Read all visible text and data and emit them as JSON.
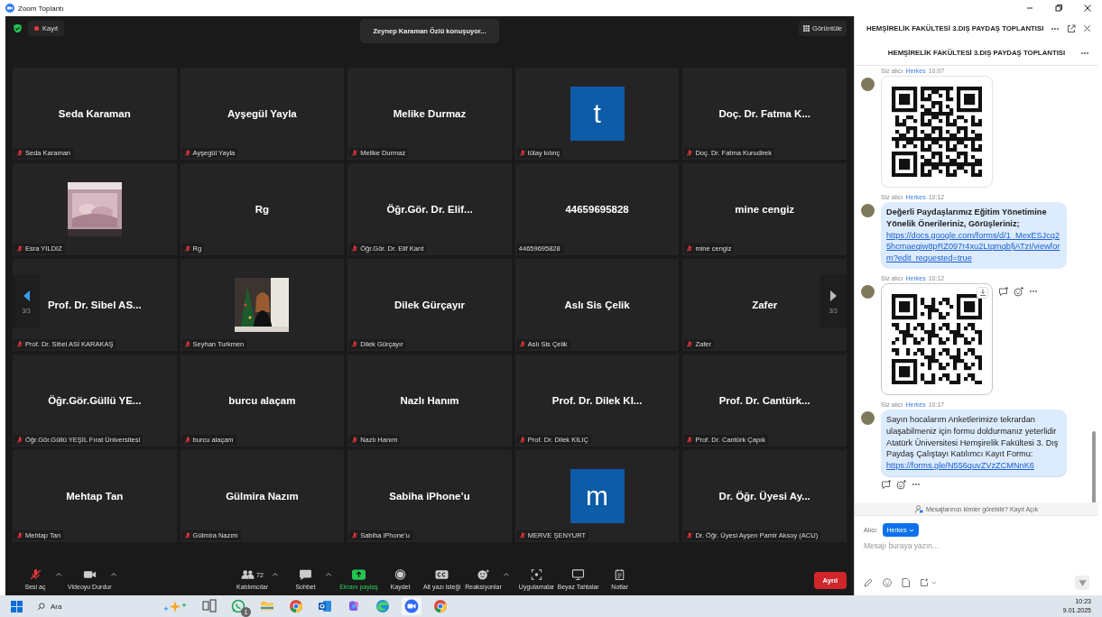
{
  "window": {
    "title": "Zoom Toplantı"
  },
  "top_bar": {
    "recording": "Kayıt",
    "speaking": "Zeynep Karaman Özlü konuşuyor...",
    "view_button": "Görüntüle"
  },
  "tiles": [
    {
      "kind": "name",
      "display": "Seda Karaman",
      "label": "Seda Karaman",
      "muted": true
    },
    {
      "kind": "name",
      "display": "Ayşegül Yayla",
      "label": "Ayşegül Yayla",
      "muted": true
    },
    {
      "kind": "name",
      "display": "Melike Durmaz",
      "label": "Melike Durmaz",
      "muted": true
    },
    {
      "kind": "avatar",
      "display": "t",
      "label": "tülay kılınç",
      "muted": true
    },
    {
      "kind": "name",
      "display": "Doç. Dr. Fatma K...",
      "label": "Doç. Dr. Fatma Kurudirek",
      "muted": true
    },
    {
      "kind": "picture",
      "label": "Esra YILDIZ",
      "muted": true
    },
    {
      "kind": "name",
      "display": "Rg",
      "label": "Rg",
      "muted": true
    },
    {
      "kind": "name",
      "display": "Öğr.Gör. Dr. Elif...",
      "label": "Öğr.Gör. Dr. Elif Kant",
      "muted": true
    },
    {
      "kind": "name",
      "display": "44659695828",
      "label": "44659695828",
      "muted": false
    },
    {
      "kind": "name",
      "display": "mine cengiz",
      "label": "mine cengiz",
      "muted": true
    },
    {
      "kind": "name",
      "display": "Prof. Dr. Sibel AS...",
      "label": "Prof. Dr. Sibel ASİ KARAKAŞ",
      "muted": true
    },
    {
      "kind": "picture",
      "label": "Seyhan Turkmen",
      "muted": true
    },
    {
      "kind": "name",
      "display": "Dilek Gürçayır",
      "label": "Dilek Gürçayır",
      "muted": true
    },
    {
      "kind": "name",
      "display": "Aslı Sis Çelik",
      "label": "Aslı Sis Çelik",
      "muted": true
    },
    {
      "kind": "name",
      "display": "Zafer",
      "label": "Zafer",
      "muted": true
    },
    {
      "kind": "name",
      "display": "Öğr.Gör.Güllü  YE...",
      "label": "Öğr.Gör.Güllü YEŞİL Fırat Üniversitesi",
      "muted": true
    },
    {
      "kind": "name",
      "display": "burcu alaçam",
      "label": "burcu alaçam",
      "muted": true
    },
    {
      "kind": "name",
      "display": "Nazlı Hanım",
      "label": "Nazlı Hanım",
      "muted": true
    },
    {
      "kind": "name",
      "display": "Prof. Dr. Dilek KI...",
      "label": "Prof. Dr. Dilek KILIÇ",
      "muted": true
    },
    {
      "kind": "name",
      "display": "Prof. Dr. Cantürk...",
      "label": "Prof. Dr. Cantürk Çapık",
      "muted": true
    },
    {
      "kind": "name",
      "display": "Mehtap Tan",
      "label": "Mehtap Tan",
      "muted": true
    },
    {
      "kind": "name",
      "display": "Gülmira Nazım",
      "label": "Gülmira Nazım",
      "muted": true
    },
    {
      "kind": "name",
      "display": "Sabiha iPhone’u",
      "label": "Sabiha iPhone’u",
      "muted": true
    },
    {
      "kind": "avatar",
      "display": "m",
      "label": "MERVE ŞENYURT",
      "muted": true
    },
    {
      "kind": "name",
      "display": "Dr. Öğr. Üyesi Ay...",
      "label": "Dr. Öğr. Üyesi Ayşen Pamir Aksoy (ACU)",
      "muted": true
    }
  ],
  "pager": {
    "left": "3/3",
    "right": "3/3"
  },
  "toolbar": {
    "left": [
      {
        "kind": "audio",
        "label": "Sesi aç",
        "muted": true,
        "menu": true
      },
      {
        "kind": "video",
        "label": "Videoyu Durdur",
        "menu": true
      }
    ],
    "center": [
      {
        "kind": "participants",
        "label": "Katılımcılar",
        "count": "72",
        "menu": true
      },
      {
        "kind": "chat",
        "label": "Sohbet",
        "menu": true
      },
      {
        "kind": "share",
        "label": "Ekranı paylaş",
        "menu": false
      },
      {
        "kind": "record",
        "label": "Kaydet",
        "menu": false
      },
      {
        "kind": "captions",
        "label": "Alt yazı isteği",
        "menu": false
      },
      {
        "kind": "reactions",
        "label": "Reaksiyonlar",
        "menu": true
      },
      {
        "kind": "apps",
        "label": "Uygulamalar",
        "menu": false
      },
      {
        "kind": "whiteboard",
        "label": "Beyaz Tahtalar",
        "menu": false
      },
      {
        "kind": "notes",
        "label": "Notlar",
        "menu": false
      }
    ],
    "leave_button": "Ayrıl"
  },
  "chat": {
    "title": "HEMŞİRELİK FAKÜLTESİ 3.DIŞ PAYDAŞ TOPLANTISI",
    "subtitle": "HEMŞİRELİK FAKÜLTESİ 3.DIŞ PAYDAŞ TOPLANTISI",
    "messages": [
      {
        "from": "Siz alıcı",
        "recipient": "Herkes",
        "time": "10:07",
        "side_actions": false,
        "below_actions": false
      },
      {
        "kind": "text",
        "from": "Siz alıcı",
        "recipient": "Herkes",
        "time": "10:12",
        "heading": "Değerli Paydaşlarımız Eğitim Yönetimine Yönelik Önerileriniz, Görüşleriniz;",
        "link": "https://docs.google.com/forms/d/1_MexESJcq25hcmaegiw8pRZ097r4xu2LtgmgbfjATzI/viewform?edit_requested=true",
        "side_actions": false,
        "below_actions": false
      },
      {
        "from": "Siz alıcı",
        "recipient": "Herkes",
        "time": "10:12",
        "side_actions": true,
        "below_actions": false
      },
      {
        "kind": "text",
        "from": "Siz alıcı",
        "recipient": "Herkes",
        "time": "10:17",
        "text": "Sayın hocalarım Anketlerimize tekrardan ulaşabilmeniz için formu doldurmanız yeterlidir Atatürk Üniversitesi Hemşirelik Fakültesi 3. Dış Paydaş Çalıştayı Katılımcı Kayıt Formu:",
        "link": "https://forms.gle/N556quvZVzZCMNnK6",
        "side_actions": false,
        "below_actions": true
      }
    ],
    "notice": "Mesajlarınızı kimler görebilir? Kayıt Açık",
    "recipient_label": "Alıcı:",
    "recipient": "Herkes",
    "placeholder": "Mesajı buraya yazın..."
  },
  "taskbar": {
    "search": "Ara",
    "apps": [
      {
        "kind": "task-view",
        "selected": false
      },
      {
        "kind": "whatsapp",
        "badge": "1",
        "selected": false
      },
      {
        "kind": "folder",
        "selected": false
      },
      {
        "kind": "chrome",
        "selected": false
      },
      {
        "kind": "outlook",
        "selected": false
      },
      {
        "kind": "copilot",
        "selected": false
      },
      {
        "kind": "edge",
        "selected": false
      },
      {
        "kind": "zoom",
        "selected": true
      },
      {
        "kind": "chrome",
        "selected": false
      }
    ],
    "time": "10:23",
    "date": "9.01.2025"
  }
}
